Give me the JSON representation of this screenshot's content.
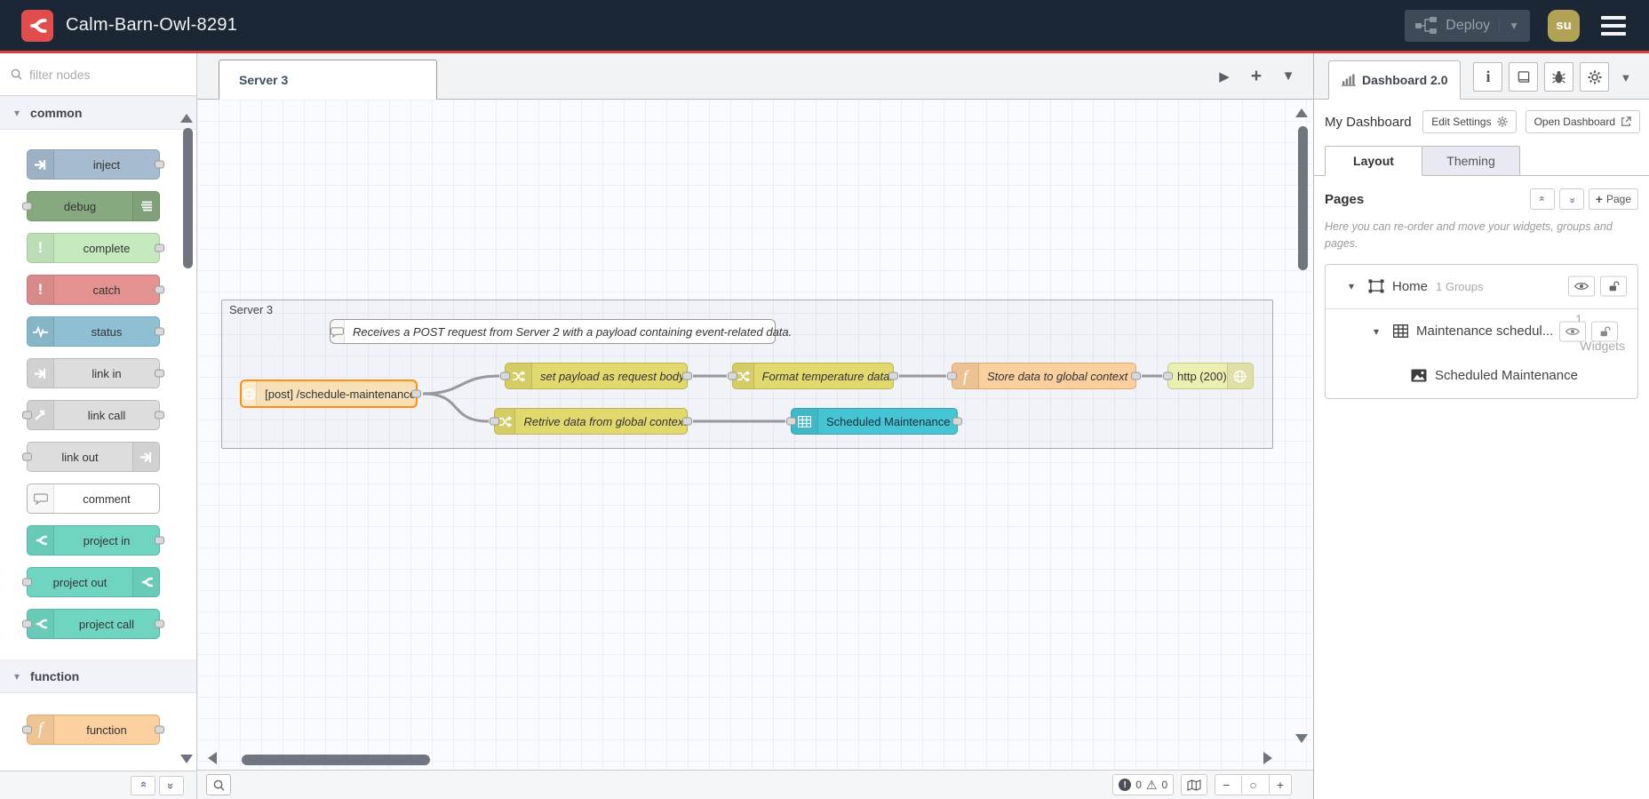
{
  "header": {
    "title": "Calm-Barn-Owl-8291",
    "deploy_label": "Deploy",
    "avatar_text": "su"
  },
  "palette": {
    "filter_placeholder": "filter nodes",
    "categories": [
      {
        "label": "common",
        "items": [
          {
            "label": "inject"
          },
          {
            "label": "debug"
          },
          {
            "label": "complete"
          },
          {
            "label": "catch"
          },
          {
            "label": "status"
          },
          {
            "label": "link in"
          },
          {
            "label": "link call"
          },
          {
            "label": "link out"
          },
          {
            "label": "comment"
          },
          {
            "label": "project in"
          },
          {
            "label": "project out"
          },
          {
            "label": "project call"
          }
        ]
      },
      {
        "label": "function",
        "items": [
          {
            "label": "function"
          }
        ]
      }
    ]
  },
  "workspace": {
    "tab_label": "Server 3",
    "group_label": "Server 3",
    "comment_text": "Receives a POST request from Server 2 with a payload containing event-related data.",
    "nodes": {
      "http_in": "[post] /schedule-maintenance",
      "change_set_payload": "set payload as request body",
      "change_retrieve": "Retrive data from global context",
      "change_format": "Format temperature data.",
      "function_store": "Store data to global context",
      "http_response": "http (200)",
      "ui_table": "Scheduled Maintenance"
    },
    "footer": {
      "error_count": "0",
      "warning_count": "0"
    }
  },
  "sidebar": {
    "tab_label": "Dashboard 2.0",
    "dashboard_name": "My Dashboard",
    "edit_settings_label": "Edit Settings",
    "open_dashboard_label": "Open Dashboard",
    "layout_tab": "Layout",
    "theming_tab": "Theming",
    "pages_title": "Pages",
    "add_page_label": "Page",
    "help_text": "Here you can re-order and move your widgets, groups and pages.",
    "tree": {
      "page_label": "Home",
      "page_meta": "1 Groups",
      "group_label": "Maintenance schedul...",
      "group_ghost_count": "1",
      "group_ghost_word": "Widgets",
      "widget_label": "Scheduled Maintenance"
    }
  },
  "colors": {
    "header_bg": "#1b2735",
    "accent_red": "#e0393f",
    "logo_red": "#e14c4c",
    "avatar_bg": "#b2a255",
    "selected_border": "#ff8f0e",
    "wire": "#999999",
    "node_inject": "#a6bbcf",
    "node_debug": "#87a980",
    "node_complete": "#c7e9c0",
    "node_catch": "#e49191",
    "node_status": "#8ebfd2",
    "node_link": "#dddddd",
    "node_comment": "#ffffff",
    "node_project": "#6fd5c1",
    "node_function": "#fbcf9e",
    "node_change": "#e2d96e",
    "node_http_in": "#f7e0b5",
    "node_http_response": "#ecefb2",
    "node_ui_table": "#46c4d3"
  }
}
